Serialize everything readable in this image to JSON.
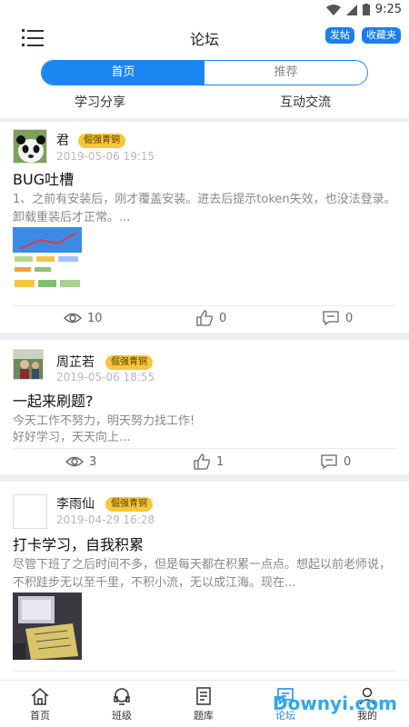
{
  "status": {
    "time": "9:25",
    "icons": [
      "wifi-icon",
      "signal-icon",
      "battery-icon"
    ]
  },
  "header": {
    "title": "论坛",
    "post_label": "发帖",
    "favorites_label": "收藏夹",
    "menu_icon": "menu-icon"
  },
  "tabs": {
    "home": "首页",
    "recommend": "推荐",
    "active": "首页"
  },
  "subtabs": {
    "study": "学习分享",
    "interact": "互动交流"
  },
  "posts": [
    {
      "user": "君",
      "badge": "倔强青铜",
      "date": "2019-05-06 19:15",
      "title": "BUG吐槽",
      "body": "1、之前有安装后，刚才覆盖安装。进去后提示token失效，也没法登录。卸载重装后才正常。...",
      "views": "10",
      "likes": "0",
      "comments": "0"
    },
    {
      "user": "周芷若",
      "badge": "倔强青铜",
      "date": "2019-05-06 18:55",
      "title": "一起来刷题?",
      "body_line1": "今天工作不努力，明天努力找工作!",
      "body_line2": "好好学习，天天向上...",
      "views": "3",
      "likes": "1",
      "comments": "0"
    },
    {
      "user": "李雨仙",
      "badge": "倔强青铜",
      "date": "2019-04-29 16:28",
      "title": "打卡学习，自我积累",
      "body": "尽管下班了之后时间不多，但是每天都在积累一点点。想起以前老师说，不积跬步无以至千里，不积小流，无以成江海。现在..."
    }
  ],
  "nav": [
    {
      "label": "首页",
      "icon": "home-icon"
    },
    {
      "label": "班级",
      "icon": "class-icon"
    },
    {
      "label": "题库",
      "icon": "question-bank-icon"
    },
    {
      "label": "论坛",
      "icon": "forum-icon"
    },
    {
      "label": "我的",
      "icon": "profile-icon"
    }
  ],
  "nav_active": "论坛",
  "watermark": "Downyi.com",
  "colors": {
    "accent": "#1a86f2",
    "badge": "#f5c73a",
    "muted": "#888888"
  }
}
